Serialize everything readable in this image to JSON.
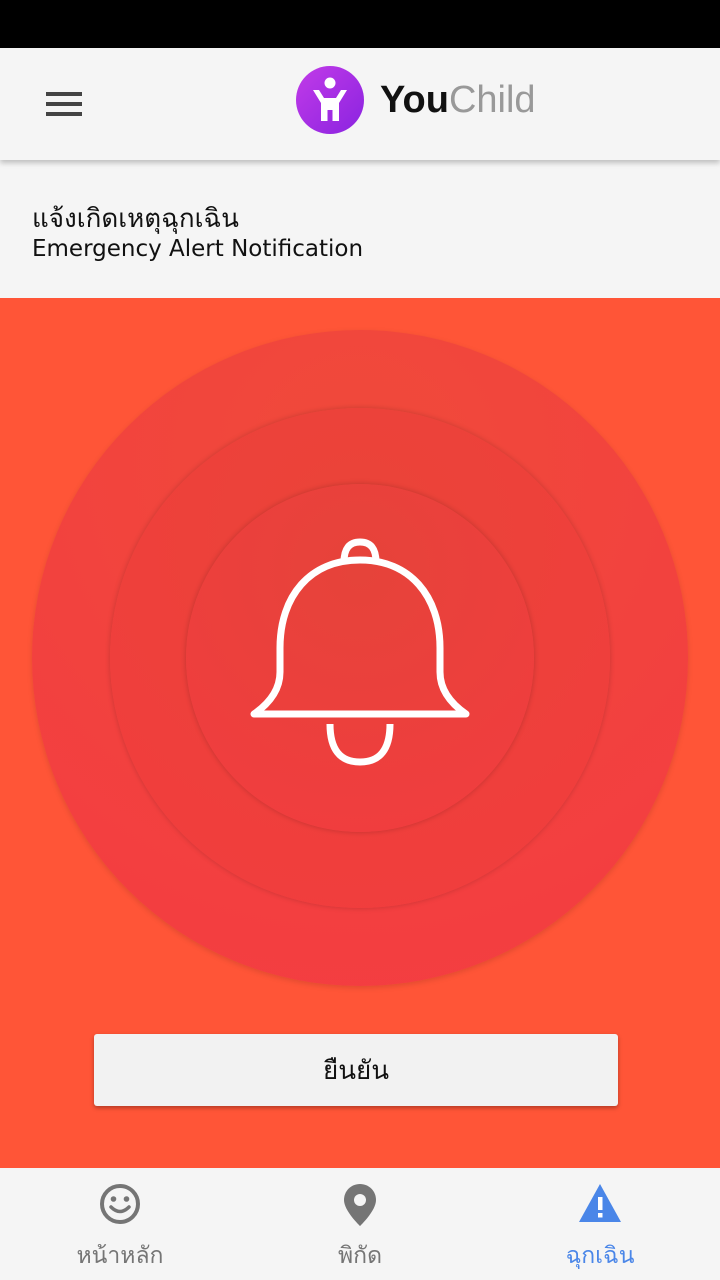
{
  "app": {
    "name_bold": "You",
    "name_light": "Child",
    "logo_color": "#a62fe6"
  },
  "header": {
    "menu_icon": "menu-icon"
  },
  "page": {
    "title_th": "แจ้งเกิดเหตุฉุกเฉิน",
    "title_en": "Emergency Alert Notification"
  },
  "alert": {
    "background": "#ff5537",
    "icon": "bell-icon",
    "confirm_label": "ยืนยัน"
  },
  "nav": {
    "items": [
      {
        "label": "หน้าหลัก",
        "icon": "smiley-icon",
        "active": false
      },
      {
        "label": "พิกัด",
        "icon": "location-pin-icon",
        "active": false
      },
      {
        "label": "ฉุกเฉิน",
        "icon": "warning-icon",
        "active": true
      }
    ],
    "active_color": "#4a86e8",
    "inactive_color": "#757575"
  }
}
